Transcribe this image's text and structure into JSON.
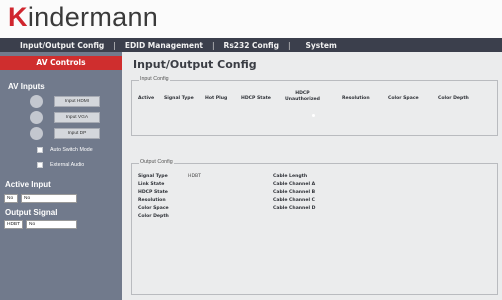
{
  "brand": {
    "logo_first": "K",
    "logo_rest": "indermann"
  },
  "nav": {
    "items": [
      {
        "label": "Input/Output Config"
      },
      {
        "label": "EDID Management"
      },
      {
        "label": "Rs232 Config"
      },
      {
        "label": "System"
      }
    ],
    "separator": "|"
  },
  "sidebar": {
    "title": "AV Controls",
    "av_inputs": {
      "heading": "AV Inputs",
      "buttons": [
        "Input HDMI",
        "Input VGA",
        "Input DP"
      ]
    },
    "checkboxes": [
      "Auto Switch Mode",
      "External Audio"
    ],
    "active_input": {
      "heading": "Active Input",
      "field1": "No",
      "field2": "No"
    },
    "output_signal": {
      "heading": "Output Signal",
      "field1": "HDBT",
      "field2": "No"
    }
  },
  "main": {
    "title": "Input/Output Config",
    "input_config": {
      "legend": "Input Config",
      "columns": [
        "Active",
        "Signal Type",
        "Hot Plug",
        "HDCP State",
        "HDCP\nUnauthorized",
        "Resolution",
        "Color Space",
        "Color Depth"
      ]
    },
    "output_config": {
      "legend": "Output Config",
      "left_labels": [
        "Signal Type",
        "Link State",
        "HDCP State",
        "Resolution",
        "Color Space",
        "Color Depth"
      ],
      "signal_type_value": "HDBT",
      "right_labels": [
        "Cable Length",
        "Cable Channel A",
        "Cable Channel B",
        "Cable Channel C",
        "Cable Channel D"
      ]
    }
  },
  "colors": {
    "brand_red": "#cf2e2e",
    "nav_bg": "#3b3f4c",
    "sidebar_bg": "#717a8c",
    "main_bg": "#ebeced"
  }
}
